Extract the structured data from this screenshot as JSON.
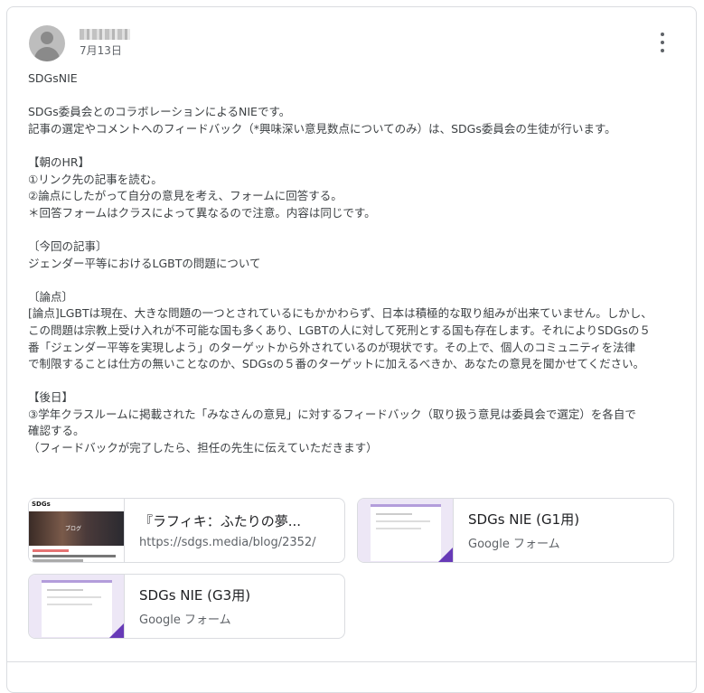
{
  "post": {
    "date": "7月13日",
    "menu_icon": "more-vert-icon",
    "lines": [
      "SDGsNIE",
      "",
      "SDGs委員会とのコラボレーションによるNIEです。",
      "記事の選定やコメントへのフィードバック（*興味深い意見数点についてのみ）は、SDGs委員会の生徒が行います。",
      "",
      "【朝のHR】",
      "①リンク先の記事を読む。",
      "②論点にしたがって自分の意見を考え、フォームに回答する。",
      "＊回答フォームはクラスによって異なるので注意。内容は同じです。",
      "",
      "〔今回の記事〕",
      "ジェンダー平等におけるLGBTの問題について",
      "",
      "〔論点〕",
      "[論点]LGBTは現在、大きな問題の一つとされているにもかかわらず、日本は積極的な取り組みが出来ていません。しかし、",
      "この問題は宗教上受け入れが不可能な国も多くあり、LGBTの人に対して死刑とする国も存在します。それによりSDGsの５",
      "番「ジェンダー平等を実現しよう」のターゲットから外されているのが現状です。その上で、個人のコミュニティを法律",
      "で制限することは仕方の無いことなのか、SDGsの５番のターゲットに加えるべきか、あなたの意見を聞かせてください。",
      "",
      "【後日】",
      "③学年クラスルームに掲載された「みなさんの意見」に対するフィードバック（取り扱う意見は委員会で選定）を各自で",
      "確認する。",
      "（フィードバックが完了したら、担任の先生に伝えていただきます）"
    ]
  },
  "attachments": [
    {
      "title": "『ラフィキ：ふたりの夢...",
      "subtitle": "https://sdgs.media/blog/2352/",
      "thumb": "blog"
    },
    {
      "title": "SDGs NIE (G1用)",
      "subtitle": "Google フォーム",
      "thumb": "form"
    },
    {
      "title": "SDGs NIE (G3用)",
      "subtitle": "Google フォーム",
      "thumb": "form"
    }
  ],
  "thumb_text": {
    "logo": "SDGs",
    "hero": "ブログ"
  }
}
